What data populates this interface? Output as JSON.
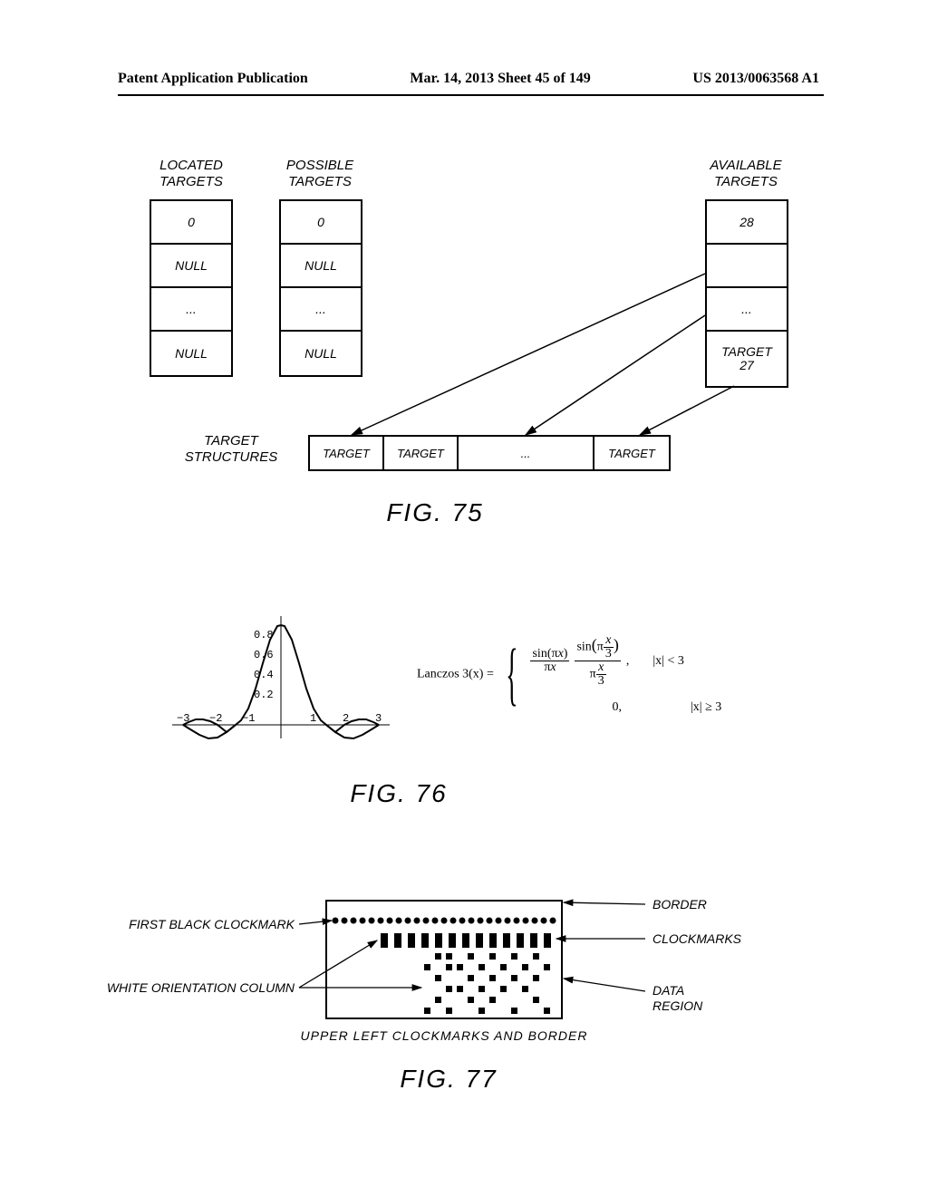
{
  "header": {
    "left": "Patent Application Publication",
    "center": "Mar. 14, 2013  Sheet 45 of 149",
    "right": "US 2013/0063568 A1"
  },
  "fig75": {
    "labels": {
      "located": "LOCATED\nTARGETS",
      "possible": "POSSIBLE\nTARGETS",
      "available": "AVAILABLE\nTARGETS",
      "structures": "TARGET\nSTRUCTURES"
    },
    "located_col": [
      "0",
      "NULL",
      "...",
      "NULL"
    ],
    "possible_col": [
      "0",
      "NULL",
      "...",
      "NULL"
    ],
    "available_col": [
      "28",
      "",
      "...",
      "TARGET\n27"
    ],
    "row": [
      "TARGET",
      "TARGET",
      "...",
      "TARGET"
    ],
    "caption": "FIG. 75"
  },
  "fig76": {
    "caption": "FIG. 76",
    "formula_name": "Lanczos 3(x) =",
    "cond1": "|x| < 3",
    "cond2": "|x| ≥ 3",
    "zero": "0,",
    "yticks": [
      "0.8",
      "0.6",
      "0.4",
      "0.2"
    ],
    "xticks": [
      "−3",
      "−2",
      "−1",
      "1",
      "2",
      "3"
    ]
  },
  "fig77": {
    "labels": {
      "first_black": "FIRST BLACK CLOCKMARK",
      "white_orient": "WHITE ORIENTATION COLUMN",
      "border": "BORDER",
      "clockmarks": "CLOCKMARKS",
      "data_region": "DATA\nREGION"
    },
    "subtitle": "UPPER LEFT CLOCKMARKS AND BORDER",
    "caption": "FIG. 77"
  }
}
